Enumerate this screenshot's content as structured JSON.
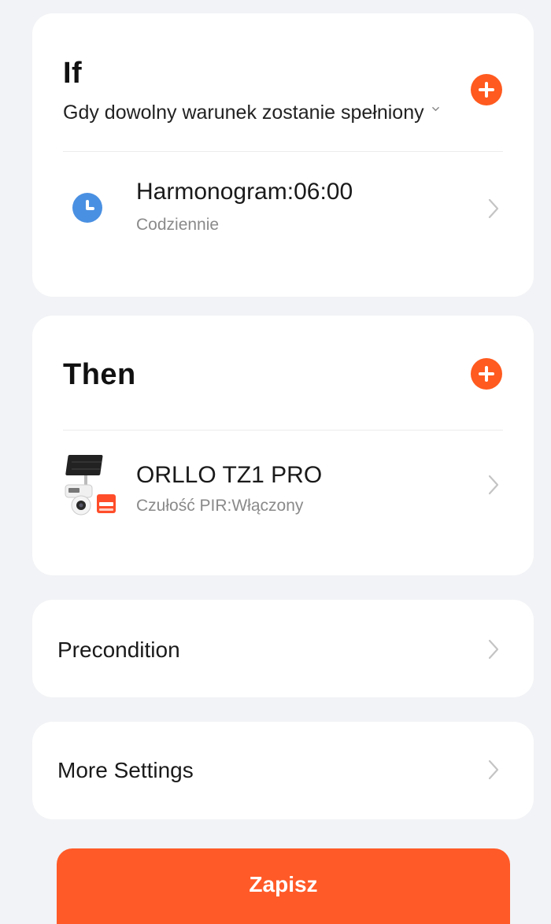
{
  "if_section": {
    "title": "If",
    "condition_label": "Gdy dowolny warunek zostanie spełniony",
    "add_icon": "plus-circle-icon",
    "conditions": [
      {
        "icon": "clock-icon",
        "title": "Harmonogram:06:00",
        "subtitle": "Codziennie"
      }
    ]
  },
  "then_section": {
    "title": "Then",
    "add_icon": "plus-circle-icon",
    "actions": [
      {
        "icon": "camera-device-image",
        "title": "ORLLO TZ1 PRO",
        "subtitle": "Czułość PIR:Włączony"
      }
    ]
  },
  "precondition": {
    "label": "Precondition"
  },
  "more_settings": {
    "label": "More Settings"
  },
  "save_button": {
    "label": "Zapisz"
  },
  "colors": {
    "accent": "#ff5a28",
    "background": "#f2f3f6",
    "card": "#ffffff",
    "clock_blue": "#4a90e2",
    "secondary_text": "#8a8a8a"
  }
}
